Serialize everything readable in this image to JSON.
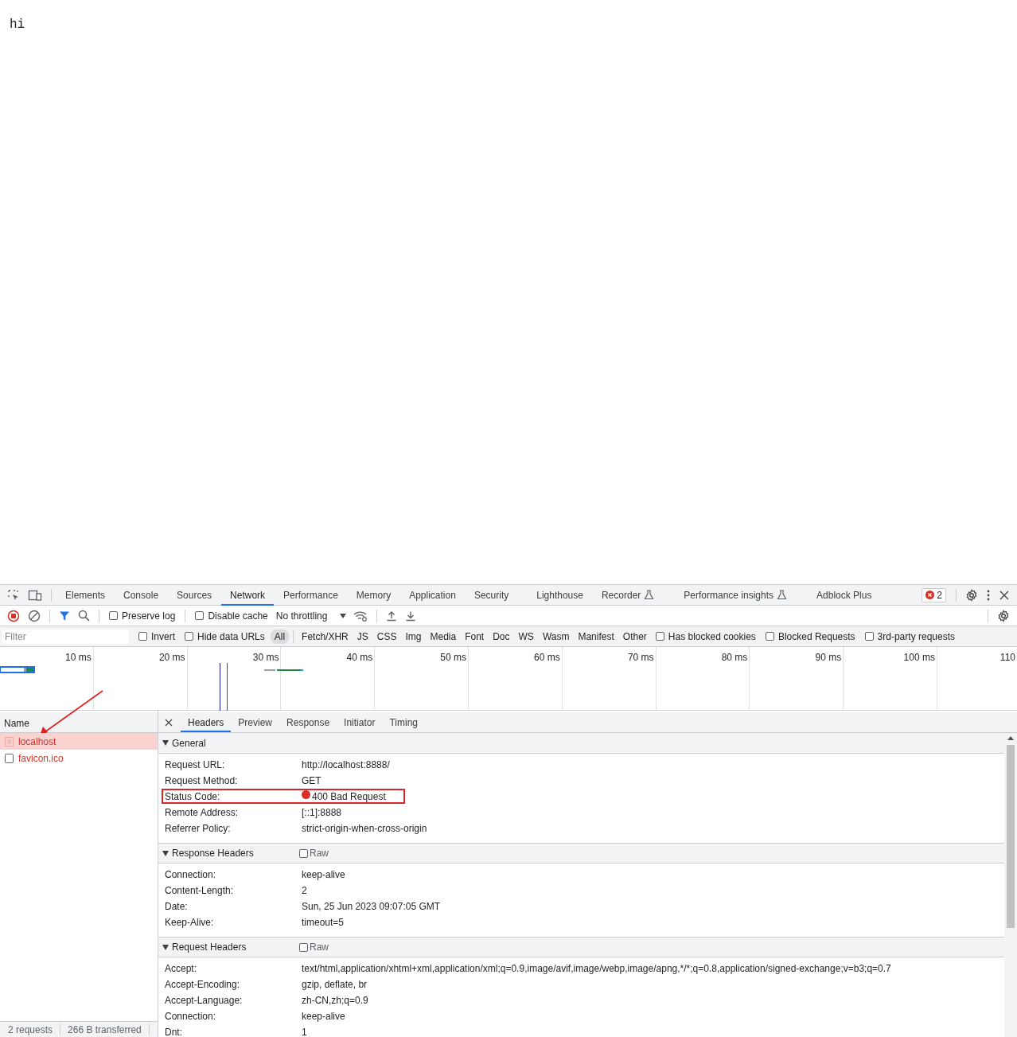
{
  "page": {
    "text": "hi"
  },
  "devtools": {
    "tabs": [
      {
        "label": "Elements",
        "selected": false
      },
      {
        "label": "Console",
        "selected": false
      },
      {
        "label": "Sources",
        "selected": false
      },
      {
        "label": "Network",
        "selected": true
      },
      {
        "label": "Performance",
        "selected": false
      },
      {
        "label": "Memory",
        "selected": false
      },
      {
        "label": "Application",
        "selected": false
      },
      {
        "label": "Security",
        "selected": false
      },
      {
        "label": "Lighthouse",
        "selected": false
      },
      {
        "label": "Recorder",
        "selected": false,
        "experimental": true
      },
      {
        "label": "Performance insights",
        "selected": false,
        "experimental": true
      },
      {
        "label": "Adblock Plus",
        "selected": false
      }
    ],
    "error_count": "2",
    "toolbar": {
      "recording": true,
      "filter_active": true,
      "checkboxes": [
        {
          "label": "Preserve log",
          "checked": false
        },
        {
          "label": "Disable cache",
          "checked": false
        }
      ],
      "throttling": "No throttling"
    },
    "filter_bar": {
      "placeholder": "Filter",
      "options": [
        {
          "label": "Invert",
          "checked": false
        },
        {
          "label": "Hide data URLs",
          "checked": false
        }
      ],
      "types": [
        {
          "label": "All",
          "selected": true
        },
        {
          "label": "Fetch/XHR",
          "selected": false
        },
        {
          "label": "JS",
          "selected": false
        },
        {
          "label": "CSS",
          "selected": false
        },
        {
          "label": "Img",
          "selected": false
        },
        {
          "label": "Media",
          "selected": false
        },
        {
          "label": "Font",
          "selected": false
        },
        {
          "label": "Doc",
          "selected": false
        },
        {
          "label": "WS",
          "selected": false
        },
        {
          "label": "Wasm",
          "selected": false
        },
        {
          "label": "Manifest",
          "selected": false
        },
        {
          "label": "Other",
          "selected": false
        }
      ],
      "extra_options": [
        {
          "label": "Has blocked cookies",
          "checked": false
        },
        {
          "label": "Blocked Requests",
          "checked": false
        },
        {
          "label": "3rd-party requests",
          "checked": false
        }
      ]
    },
    "timeline": {
      "ticks": [
        "10 ms",
        "20 ms",
        "30 ms",
        "40 ms",
        "50 ms",
        "60 ms",
        "70 ms",
        "80 ms",
        "90 ms",
        "100 ms",
        "110"
      ]
    },
    "requests": {
      "column": "Name",
      "rows": [
        {
          "name": "localhost",
          "kind": "document",
          "selected": true,
          "failed": true,
          "arrow_pointer": true
        },
        {
          "name": "favicon.ico",
          "kind": "image",
          "selected": false,
          "failed": true
        }
      ]
    },
    "status_bar": [
      "2 requests",
      "266 B transferred"
    ],
    "details": {
      "tabs": [
        {
          "label": "Headers",
          "selected": true
        },
        {
          "label": "Preview",
          "selected": false
        },
        {
          "label": "Response",
          "selected": false
        },
        {
          "label": "Initiator",
          "selected": false
        },
        {
          "label": "Timing",
          "selected": false
        }
      ],
      "sections": [
        {
          "title": "General",
          "expanded": true,
          "rows": [
            {
              "key": "Request URL:",
              "value": "http://localhost:8888/"
            },
            {
              "key": "Request Method:",
              "value": "GET"
            },
            {
              "key": "Status Code:",
              "value": "400 Bad Request",
              "color": "#d93025",
              "highlighted": true
            },
            {
              "key": "Remote Address:",
              "value": "[::1]:8888"
            },
            {
              "key": "Referrer Policy:",
              "value": "strict-origin-when-cross-origin"
            }
          ]
        },
        {
          "title": "Response Headers",
          "expanded": true,
          "raw": {
            "label": "Raw",
            "checked": false
          },
          "rows": [
            {
              "key": "Connection:",
              "value": "keep-alive"
            },
            {
              "key": "Content-Length:",
              "value": "2"
            },
            {
              "key": "Date:",
              "value": "Sun, 25 Jun 2023 09:07:05 GMT"
            },
            {
              "key": "Keep-Alive:",
              "value": "timeout=5"
            }
          ]
        },
        {
          "title": "Request Headers",
          "expanded": true,
          "raw": {
            "label": "Raw",
            "checked": false
          },
          "rows": [
            {
              "key": "Accept:",
              "value": "text/html,application/xhtml+xml,application/xml;q=0.9,image/avif,image/webp,image/apng,*/*;q=0.8,application/signed-exchange;v=b3;q=0.7"
            },
            {
              "key": "Accept-Encoding:",
              "value": "gzip, deflate, br"
            },
            {
              "key": "Accept-Language:",
              "value": "zh-CN,zh;q=0.9"
            },
            {
              "key": "Connection:",
              "value": "keep-alive"
            },
            {
              "key": "Dnt:",
              "value": "1"
            }
          ]
        }
      ]
    }
  }
}
